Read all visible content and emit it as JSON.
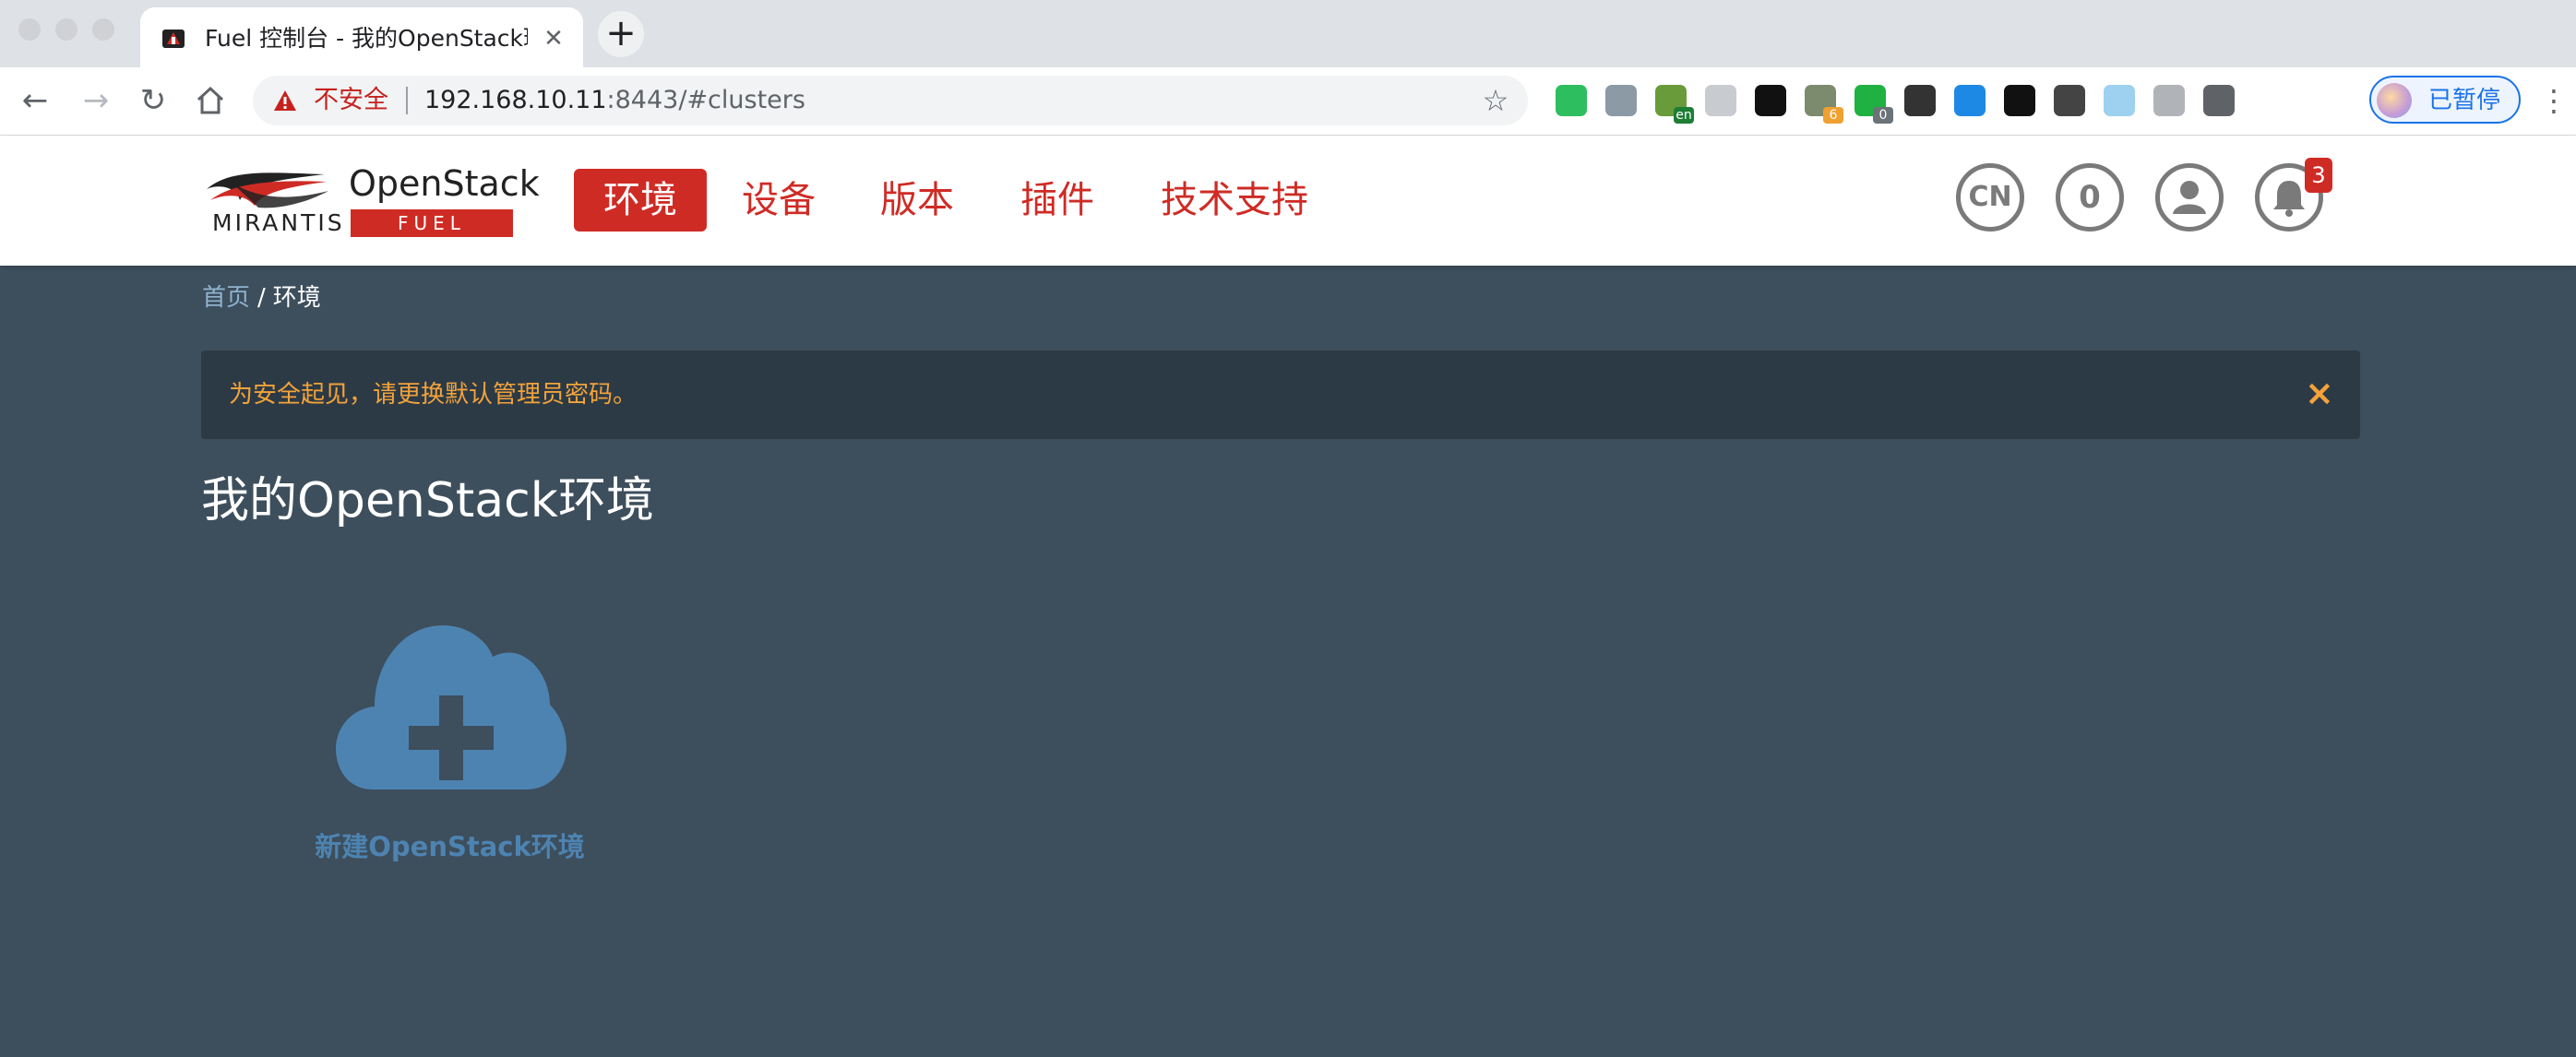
{
  "browser": {
    "tab": {
      "title": "Fuel 控制台 - 我的OpenStack环",
      "close_glyph": "✕"
    },
    "new_tab_glyph": "+",
    "omnibox": {
      "security_label": "不安全",
      "url_host": "192.168.10.11",
      "url_rest": ":8443/#clusters"
    },
    "extensions": [
      {
        "name": "evernote-icon",
        "color": "#2dbe60",
        "badge": ""
      },
      {
        "name": "download-icon",
        "color": "#8c9aa6",
        "badge": ""
      },
      {
        "name": "translate-icon",
        "color": "#6a9b3a",
        "badge": "en"
      },
      {
        "name": "cloud-icon",
        "color": "#c8ccd0",
        "badge": ""
      },
      {
        "name": "tampermonkey-icon",
        "color": "#111111",
        "badge": ""
      },
      {
        "name": "circle-extension-icon",
        "color": "#7c8a6e",
        "badge": "6"
      },
      {
        "name": "shield-check-icon",
        "color": "#1fb141",
        "badge": "0"
      },
      {
        "name": "gitzip-icon",
        "color": "#333333",
        "badge": ""
      },
      {
        "name": "screen-capture-icon",
        "color": "#1e88e5",
        "badge": ""
      },
      {
        "name": "play-circle-icon",
        "color": "#111111",
        "badge": ""
      },
      {
        "name": "pen-tool-icon",
        "color": "#444444",
        "badge": ""
      },
      {
        "name": "cloud-sync-icon",
        "color": "#9ed0ef",
        "badge": ""
      },
      {
        "name": "crown-icon",
        "color": "#b0b4b8",
        "badge": ""
      },
      {
        "name": "puzzle-icon",
        "color": "#5f6368",
        "badge": ""
      }
    ],
    "profile_label": "已暂停"
  },
  "app": {
    "logo": {
      "wordmark": "MIRANTIS",
      "product": "OpenStack",
      "sub": "FUEL"
    },
    "nav": [
      {
        "label": "环境",
        "active": true
      },
      {
        "label": "设备",
        "active": false
      },
      {
        "label": "版本",
        "active": false
      },
      {
        "label": "插件",
        "active": false
      },
      {
        "label": "技术支持",
        "active": false
      }
    ],
    "header_controls": {
      "language": "CN",
      "counter": "0",
      "notifications_badge": "3"
    },
    "colors": {
      "brand_red": "#cf2b25",
      "content_bg": "#3d4e5c",
      "alert_text": "#f3a33a",
      "link_blue": "#4d83b1"
    }
  },
  "breadcrumb": {
    "home": "首页",
    "separator": "/",
    "current": "环境"
  },
  "alert": {
    "message": "为安全起见，请更换默认管理员密码。",
    "close_glyph": "×"
  },
  "page": {
    "title": "我的OpenStack环境",
    "new_env_label": "新建OpenStack环境"
  }
}
